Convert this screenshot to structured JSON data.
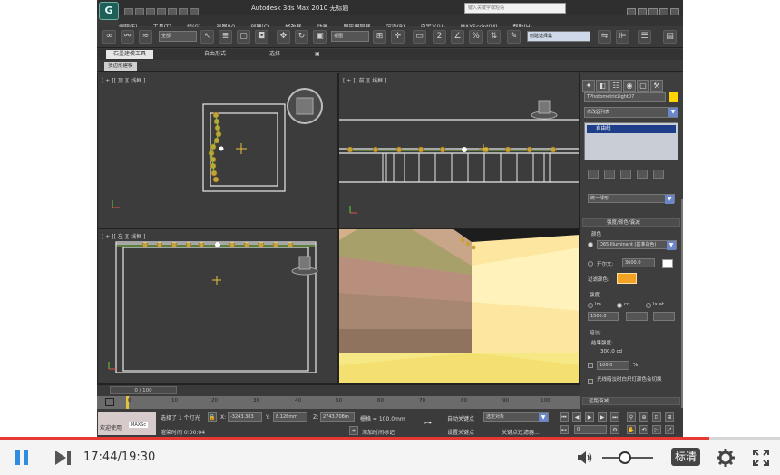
{
  "app": {
    "title": "Autodesk 3ds Max  2010    无标题",
    "logo": "G",
    "search_placeholder": "键入关键字或短语"
  },
  "menu": [
    "编辑(E)",
    "工具(T)",
    "组(G)",
    "视图(V)",
    "创建(C)",
    "修改器",
    "动画",
    "图形编辑器",
    "渲染(R)",
    "自定义(U)",
    "MAXScript(M)",
    "帮助(H)"
  ],
  "toolbar": {
    "selection_filter": "全部",
    "ref_coord": "视图",
    "named_selection": "创建选择集"
  },
  "ribbon": {
    "tabs": [
      "石墨建模工具",
      "自由形式",
      "选择",
      "▣"
    ],
    "panel_label": "多边形建模"
  },
  "viewports": {
    "top": "[ + ][ 顶 ][ 线框 ]",
    "front": "[ + ][ 前 ][ 线框 ]",
    "left": "[ + ][ 左 ][ 线框 ]"
  },
  "command_panel": {
    "object_name": "TPhotometricLight07",
    "modifier_list": "修改器列表",
    "stack_item": "自由线",
    "distribution": "统一球形",
    "rollout_intensity": "强度/颜色/衰减",
    "color_label": "颜色",
    "color_preset": "D65 Illuminant (基准白色)",
    "kelvin_label": "开尔文:",
    "kelvin_value": "3600.0",
    "filter_color_label": "过滤颜色:",
    "strength_label": "强度",
    "units": [
      "lm",
      "cd",
      "lx at"
    ],
    "intensity_value": "1500.0",
    "dimming_label": "暗淡:",
    "result_label": "结果强度:",
    "result_value": "300.0 cd",
    "percent_value": "100.0",
    "percent_unit": "%",
    "incandescent_label": "光线暗淡时白炽灯颜色会切换",
    "far_atten": "远距衰减"
  },
  "timeline": {
    "slider_label": "0 / 100",
    "ticks": [
      "0",
      "10",
      "20",
      "30",
      "40",
      "50",
      "60",
      "70",
      "80",
      "90",
      "100"
    ]
  },
  "status": {
    "welcome": "欢迎使用",
    "script_tag": "MAXSc",
    "selected": "选择了 1 个灯光",
    "render_time": "渲染时间 0:00:04",
    "x_label": "X:",
    "x_value": "-3243.383",
    "y_label": "Y:",
    "y_value": "8.126mm",
    "z_label": "Z:",
    "z_value": "2743.708m",
    "grid": "栅格 = 100.0mm",
    "add_time_tag": "添加时间标记",
    "auto_key": "自动关键点",
    "set_key": "设置关键点",
    "selected_obj": "选定对象",
    "key_filters": "关键点过滤器...",
    "frame_value": "0"
  },
  "player": {
    "current_time": "17:44",
    "duration": "19:30",
    "progress": 0.9094,
    "volume": 0.45,
    "quality": "标清",
    "accent_color": "#e53935"
  }
}
